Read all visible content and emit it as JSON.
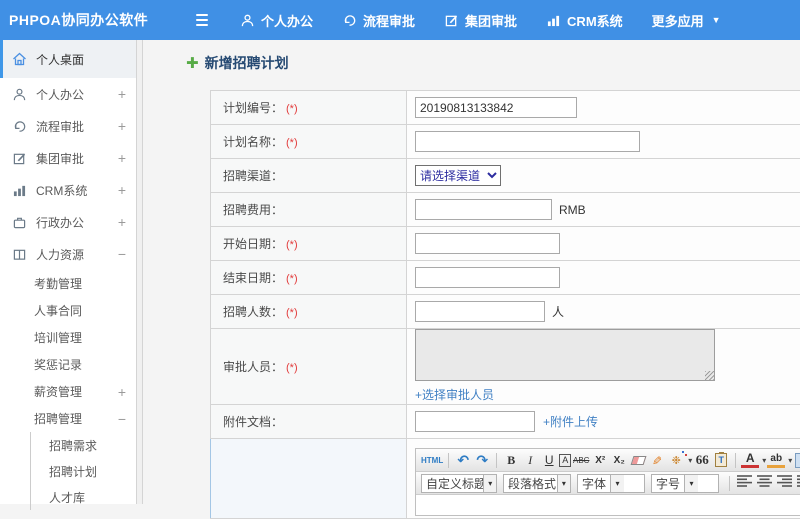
{
  "topbar": {
    "logo": "PHPOA协同办公软件",
    "nav": [
      {
        "label": "个人办公"
      },
      {
        "label": "流程审批"
      },
      {
        "label": "集团审批"
      },
      {
        "label": "CRM系统"
      },
      {
        "label": "更多应用"
      }
    ],
    "more_caret": "▼"
  },
  "sidebar": {
    "items": [
      {
        "label": "个人桌面",
        "toggle": ""
      },
      {
        "label": "个人办公",
        "toggle": "+"
      },
      {
        "label": "流程审批",
        "toggle": "+"
      },
      {
        "label": "集团审批",
        "toggle": "+"
      },
      {
        "label": "CRM系统",
        "toggle": "+"
      },
      {
        "label": "行政办公",
        "toggle": "+"
      },
      {
        "label": "人力资源",
        "toggle": "−"
      }
    ],
    "hr_sub": [
      {
        "label": "考勤管理",
        "toggle": ""
      },
      {
        "label": "人事合同",
        "toggle": ""
      },
      {
        "label": "培训管理",
        "toggle": ""
      },
      {
        "label": "奖惩记录",
        "toggle": ""
      },
      {
        "label": "薪资管理",
        "toggle": "+"
      },
      {
        "label": "招聘管理",
        "toggle": "−"
      }
    ],
    "recruit_sub": [
      {
        "label": "招聘需求"
      },
      {
        "label": "招聘计划"
      },
      {
        "label": "人才库"
      }
    ]
  },
  "page": {
    "title": "新增招聘计划",
    "plus_glyph": "✚"
  },
  "form": {
    "required_mark": "(*)",
    "rows": [
      {
        "label": "计划编号：",
        "value": "20190813133842"
      },
      {
        "label": "计划名称：",
        "value": ""
      },
      {
        "label": "招聘渠道：",
        "select_value": "请选择渠道"
      },
      {
        "label": "招聘费用：",
        "value": "",
        "suffix": "RMB"
      },
      {
        "label": "开始日期：",
        "value": ""
      },
      {
        "label": "结束日期：",
        "value": ""
      },
      {
        "label": "招聘人数：",
        "value": "",
        "suffix": "人"
      },
      {
        "label": "审批人员：",
        "link": "+选择审批人员"
      },
      {
        "label": "附件文档：",
        "value": "",
        "link": "+附件上传"
      }
    ]
  },
  "editor": {
    "toolbar": {
      "html": "HTML",
      "undo": "↶",
      "redo": "↷",
      "bold": "B",
      "italic": "I",
      "underline": "U",
      "font_border": "A",
      "strike": "ABC",
      "sup": "X²",
      "sub": "X₂",
      "brush": "✎",
      "magic": "❉",
      "quote": "66",
      "paste": "T",
      "font_color": "A",
      "highlight": "ab",
      "caret": "▾"
    },
    "dropdowns": {
      "custom_title": "自定义标题",
      "paragraph": "段落格式",
      "font": "字体",
      "size": "字号"
    }
  },
  "colors": {
    "header_blue": "#4090e5",
    "link_blue": "#4181c4",
    "required_red": "#e23c3c",
    "title_navy": "#264a73",
    "select_text": "#2d2da0",
    "plus_green": "#57ab46",
    "active_item_bg": "#eef1f4"
  }
}
